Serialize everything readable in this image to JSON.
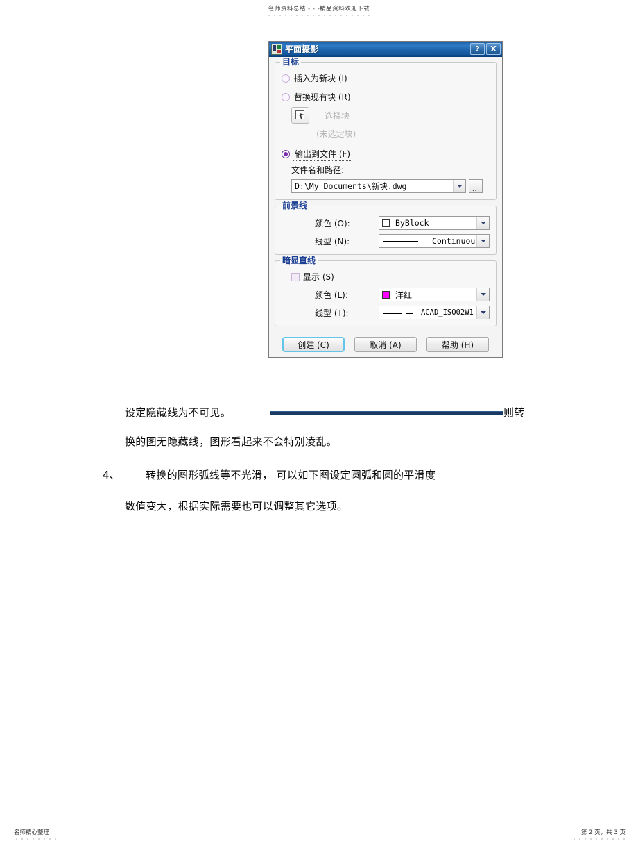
{
  "page_header": {
    "text": "名师资料总结 - - -精品资料欢迎下载"
  },
  "dialog": {
    "title": "平面摄影",
    "icon": "flatshot-icon",
    "titlebar_buttons": [
      {
        "name": "help-button",
        "label": "?"
      },
      {
        "name": "close-button",
        "label": "X"
      }
    ],
    "destination_group": {
      "legend": "目标",
      "radio_insert_as_new_block": {
        "label": "插入为新块 (I)",
        "selected": false
      },
      "radio_replace_existing_block": {
        "label": "替换现有块 (R)",
        "selected": false
      },
      "select_block_button_label": "选择块",
      "no_block_selected_text": "(未选定块)",
      "radio_export_to_file": {
        "label": "输出到文件 (F)",
        "selected": true,
        "focused": true
      },
      "filename_label": "文件名和路径:",
      "filename_value": "D:\\My Documents\\新块.dwg",
      "browse_button_label": "..."
    },
    "foreground_group": {
      "legend": "前景线",
      "color_label": "颜色 (O):",
      "color_value": "ByBlock",
      "color_swatch": "#ffffff",
      "linetype_label": "线型 (N):",
      "linetype_value": "Continuous"
    },
    "obscured_group": {
      "legend": "暗显直线",
      "show_checkbox_label": "显示 (S)",
      "show_checked": false,
      "color_label": "颜色 (L):",
      "color_value": "洋红",
      "color_swatch": "#ff00ff",
      "linetype_label": "线型 (T):",
      "linetype_value": "ACAD_ISO02W1"
    },
    "buttons": {
      "create": "创建 (C)",
      "cancel": "取消 (A)",
      "help": "帮助 (H)"
    }
  },
  "body_text": {
    "line1": "设定隐藏线为不可见。",
    "line1_tail": "则转",
    "line2": "换的图无隐藏线，图形看起来不会特别凌乱。",
    "item4_number": "4、",
    "item4_line1": "转换的图形弧线等不光滑， 可以如下图设定圆弧和圆的平滑度",
    "item4_line2": "数值变大，根据实际需要也可以调整其它选项。"
  },
  "page_footer": {
    "left": "名师精心整理",
    "right": "第 2 页，共 3 页"
  }
}
